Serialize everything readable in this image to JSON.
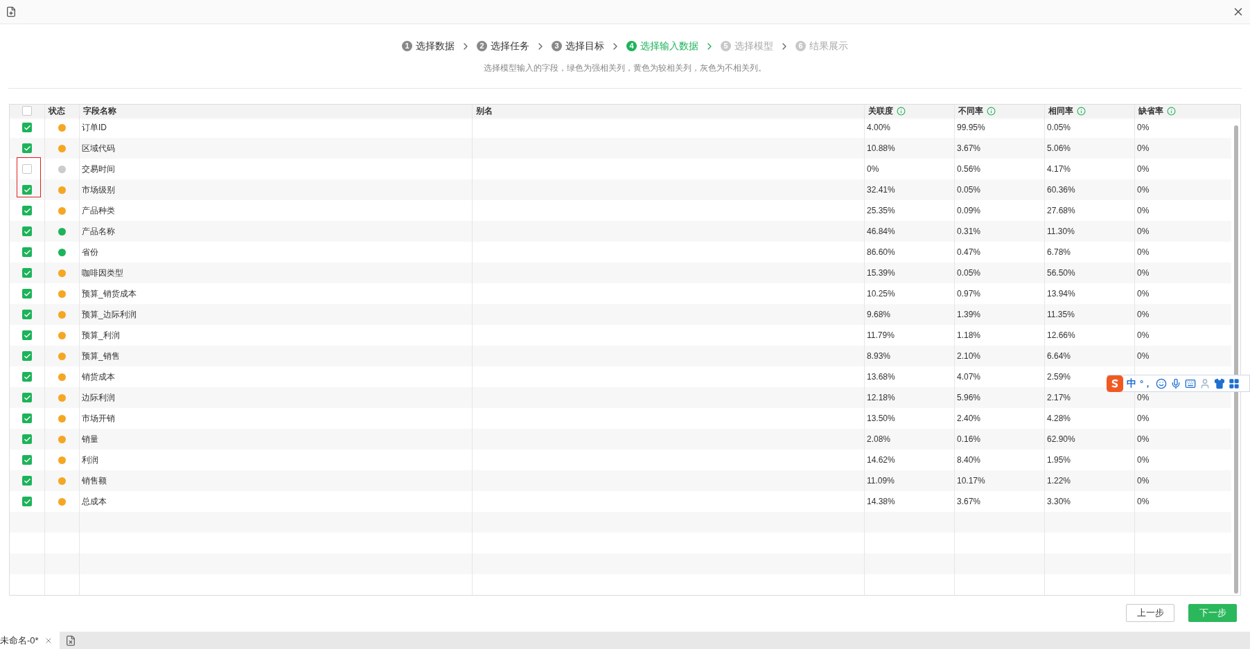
{
  "steps": [
    {
      "number": "1",
      "label": "选择数据",
      "kind": "done"
    },
    {
      "number": "2",
      "label": "选择任务",
      "kind": "done"
    },
    {
      "number": "3",
      "label": "选择目标",
      "kind": "done"
    },
    {
      "number": "4",
      "label": "选择输入数据",
      "kind": "current"
    },
    {
      "number": "5",
      "label": "选择模型",
      "kind": "pending"
    },
    {
      "number": "6",
      "label": "结果展示",
      "kind": "pending"
    }
  ],
  "hint": "选择模型输入的字段，绿色为强相关列，黄色为较相关列，灰色为不相关列。",
  "table": {
    "select_all_checked": false,
    "columns": [
      {
        "label": "状态",
        "info": false
      },
      {
        "label": "字段名称",
        "info": false
      },
      {
        "label": "别名",
        "info": false
      },
      {
        "label": "关联度",
        "info": true
      },
      {
        "label": "不同率",
        "info": true
      },
      {
        "label": "相同率",
        "info": true
      },
      {
        "label": "缺省率",
        "info": true
      }
    ],
    "rows": [
      {
        "checked": true,
        "color": "#f5a623",
        "name": "订单ID",
        "relevance": "4.00%",
        "different": "99.95%",
        "same": "0.05%",
        "missing": "0%"
      },
      {
        "checked": true,
        "color": "#f5a623",
        "name": "区域代码",
        "relevance": "10.88%",
        "different": "3.67%",
        "same": "5.06%",
        "missing": "0%"
      },
      {
        "checked": false,
        "color": "#cccccc",
        "name": "交易时间",
        "relevance": "0%",
        "different": "0.56%",
        "same": "4.17%",
        "missing": "0%"
      },
      {
        "checked": true,
        "color": "#f5a623",
        "name": "市场级别",
        "relevance": "32.41%",
        "different": "0.05%",
        "same": "60.36%",
        "missing": "0%"
      },
      {
        "checked": true,
        "color": "#f5a623",
        "name": "产品种类",
        "relevance": "25.35%",
        "different": "0.09%",
        "same": "27.68%",
        "missing": "0%"
      },
      {
        "checked": true,
        "color": "#1db35a",
        "name": "产品名称",
        "relevance": "46.84%",
        "different": "0.31%",
        "same": "11.30%",
        "missing": "0%"
      },
      {
        "checked": true,
        "color": "#1db35a",
        "name": "省份",
        "relevance": "86.60%",
        "different": "0.47%",
        "same": "6.78%",
        "missing": "0%"
      },
      {
        "checked": true,
        "color": "#f5a623",
        "name": "咖啡因类型",
        "relevance": "15.39%",
        "different": "0.05%",
        "same": "56.50%",
        "missing": "0%"
      },
      {
        "checked": true,
        "color": "#f5a623",
        "name": "预算_销货成本",
        "relevance": "10.25%",
        "different": "0.97%",
        "same": "13.94%",
        "missing": "0%"
      },
      {
        "checked": true,
        "color": "#f5a623",
        "name": "预算_边际利润",
        "relevance": "9.68%",
        "different": "1.39%",
        "same": "11.35%",
        "missing": "0%"
      },
      {
        "checked": true,
        "color": "#f5a623",
        "name": "预算_利润",
        "relevance": "11.79%",
        "different": "1.18%",
        "same": "12.66%",
        "missing": "0%"
      },
      {
        "checked": true,
        "color": "#f5a623",
        "name": "预算_销售",
        "relevance": "8.93%",
        "different": "2.10%",
        "same": "6.64%",
        "missing": "0%"
      },
      {
        "checked": true,
        "color": "#f5a623",
        "name": "销货成本",
        "relevance": "13.68%",
        "different": "4.07%",
        "same": "2.59%"
      },
      {
        "checked": true,
        "color": "#f5a623",
        "name": "边际利润",
        "relevance": "12.18%",
        "different": "5.96%",
        "same": "2.17%",
        "missing": "0%"
      },
      {
        "checked": true,
        "color": "#f5a623",
        "name": "市场开销",
        "relevance": "13.50%",
        "different": "2.40%",
        "same": "4.28%",
        "missing": "0%"
      },
      {
        "checked": true,
        "color": "#f5a623",
        "name": "销量",
        "relevance": "2.08%",
        "different": "0.16%",
        "same": "62.90%",
        "missing": "0%"
      },
      {
        "checked": true,
        "color": "#f5a623",
        "name": "利润",
        "relevance": "14.62%",
        "different": "8.40%",
        "same": "1.95%",
        "missing": "0%"
      },
      {
        "checked": true,
        "color": "#f5a623",
        "name": "销售额",
        "relevance": "11.09%",
        "different": "10.17%",
        "same": "1.22%",
        "missing": "0%"
      },
      {
        "checked": true,
        "color": "#f5a623",
        "name": "总成本",
        "relevance": "14.38%",
        "different": "3.67%",
        "same": "3.30%",
        "missing": "0%"
      }
    ]
  },
  "buttons": {
    "prev": "上一步",
    "next": "下一步"
  },
  "bottom_tab": {
    "label": "未命名-0*"
  },
  "ime": {
    "mode": "中",
    "punct": "°，"
  }
}
